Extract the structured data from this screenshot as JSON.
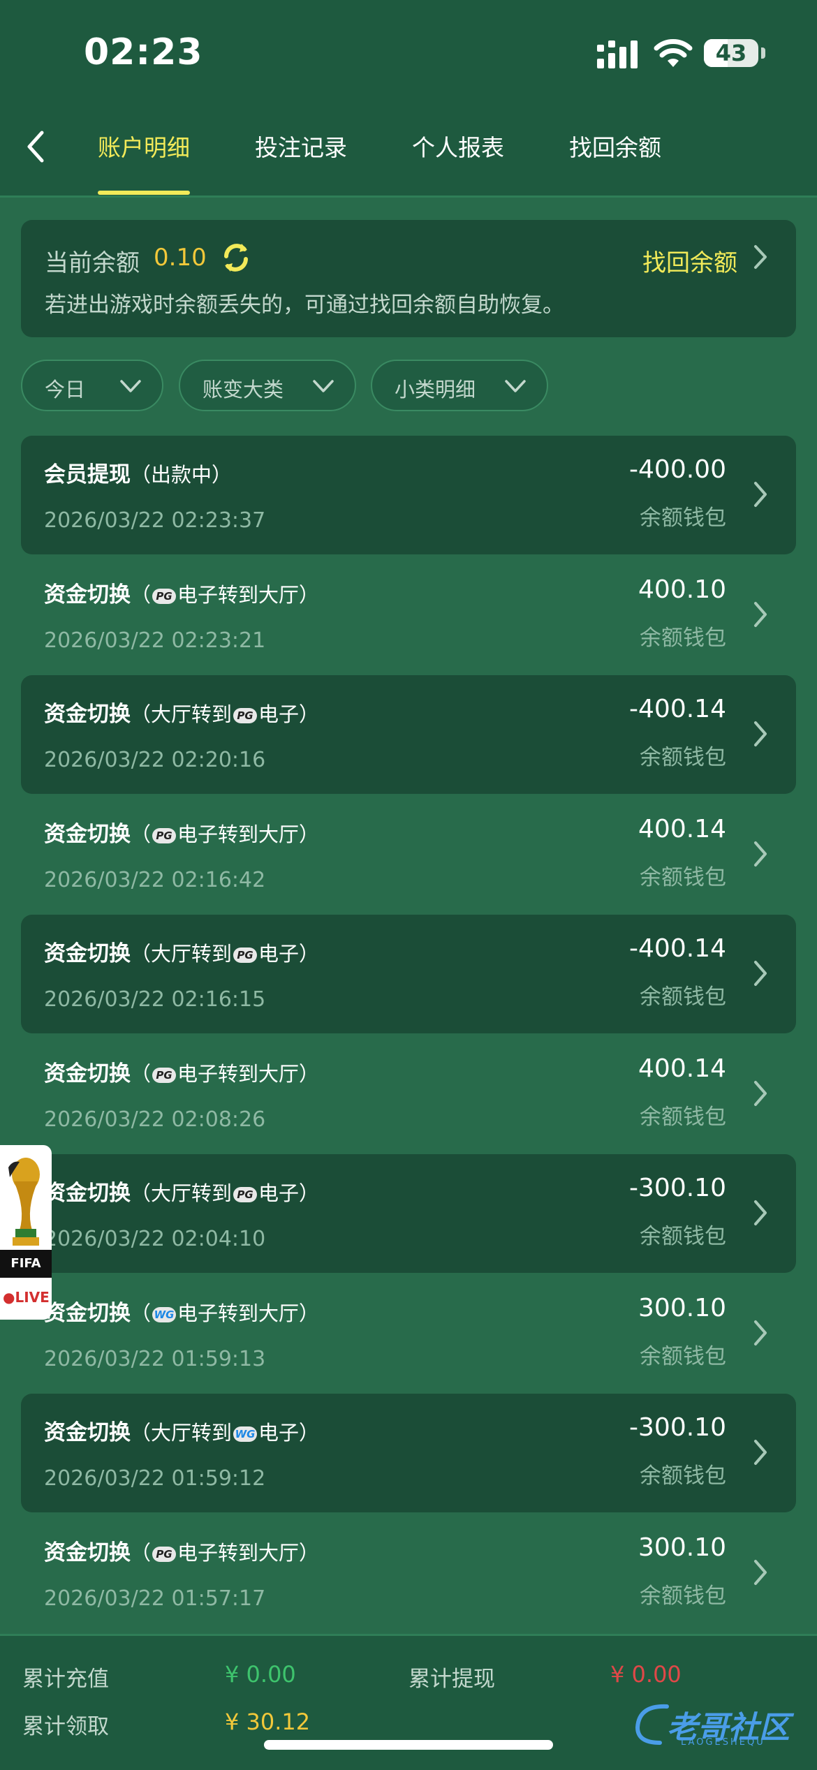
{
  "status_bar": {
    "time": "02:23",
    "battery": "43",
    "battery_level": 0.43
  },
  "nav": {
    "tabs": [
      {
        "label": "账户明细",
        "active": true
      },
      {
        "label": "投注记录",
        "active": false
      },
      {
        "label": "个人报表",
        "active": false
      },
      {
        "label": "找回余额",
        "active": false
      }
    ]
  },
  "balance": {
    "label": "当前余额",
    "value": "0.10",
    "recover_label": "找回余额",
    "hint": "若进出游戏时余额丢失的，可通过找回余额自助恢复。"
  },
  "filters": [
    {
      "label": "今日"
    },
    {
      "label": "账变大类"
    },
    {
      "label": "小类明细"
    }
  ],
  "transactions": [
    {
      "title": "会员提现",
      "detail_pre": "（出款中）",
      "logo": "",
      "detail_post": "",
      "date": "2026/03/22 02:23:37",
      "amount": "-400.00",
      "wallet": "余额钱包"
    },
    {
      "title": "资金切换",
      "detail_pre": "（",
      "logo": "PG",
      "detail_post": "电子转到大厅）",
      "date": "2026/03/22 02:23:21",
      "amount": "400.10",
      "wallet": "余额钱包"
    },
    {
      "title": "资金切换",
      "detail_pre": "（大厅转到",
      "logo": "PG",
      "detail_post": "电子）",
      "date": "2026/03/22 02:20:16",
      "amount": "-400.14",
      "wallet": "余额钱包"
    },
    {
      "title": "资金切换",
      "detail_pre": "（",
      "logo": "PG",
      "detail_post": "电子转到大厅）",
      "date": "2026/03/22 02:16:42",
      "amount": "400.14",
      "wallet": "余额钱包"
    },
    {
      "title": "资金切换",
      "detail_pre": "（大厅转到",
      "logo": "PG",
      "detail_post": "电子）",
      "date": "2026/03/22 02:16:15",
      "amount": "-400.14",
      "wallet": "余额钱包"
    },
    {
      "title": "资金切换",
      "detail_pre": "（",
      "logo": "PG",
      "detail_post": "电子转到大厅）",
      "date": "2026/03/22 02:08:26",
      "amount": "400.14",
      "wallet": "余额钱包"
    },
    {
      "title": "资金切换",
      "detail_pre": "（大厅转到",
      "logo": "PG",
      "detail_post": "电子）",
      "date": "2026/03/22 02:04:10",
      "amount": "-300.10",
      "wallet": "余额钱包"
    },
    {
      "title": "资金切换",
      "detail_pre": "（",
      "logo": "WG",
      "detail_post": "电子转到大厅）",
      "date": "2026/03/22 01:59:13",
      "amount": "300.10",
      "wallet": "余额钱包"
    },
    {
      "title": "资金切换",
      "detail_pre": "（大厅转到",
      "logo": "WG",
      "detail_post": "电子）",
      "date": "2026/03/22 01:59:12",
      "amount": "-300.10",
      "wallet": "余额钱包"
    },
    {
      "title": "资金切换",
      "detail_pre": "（",
      "logo": "PG",
      "detail_post": "电子转到大厅）",
      "date": "2026/03/22 01:57:17",
      "amount": "300.10",
      "wallet": "余额钱包"
    }
  ],
  "fifa_badge": {
    "label": "FIFA",
    "live": "●LIVE"
  },
  "summary": {
    "deposit_label": "累计充值",
    "deposit_value": "¥ 0.00",
    "withdraw_label": "累计提现",
    "withdraw_value": "¥ 0.00",
    "claim_label": "累计领取",
    "claim_value": "¥ 30.12"
  },
  "watermark": {
    "text": "老哥社区",
    "sub": "LAOGESHEQU"
  },
  "colors": {
    "accent": "#f2ea59",
    "balance": "#f2c83a",
    "positive": "#3ec46d",
    "negative": "#e04848",
    "card": "#1b4d37",
    "background": "#286b4b"
  }
}
